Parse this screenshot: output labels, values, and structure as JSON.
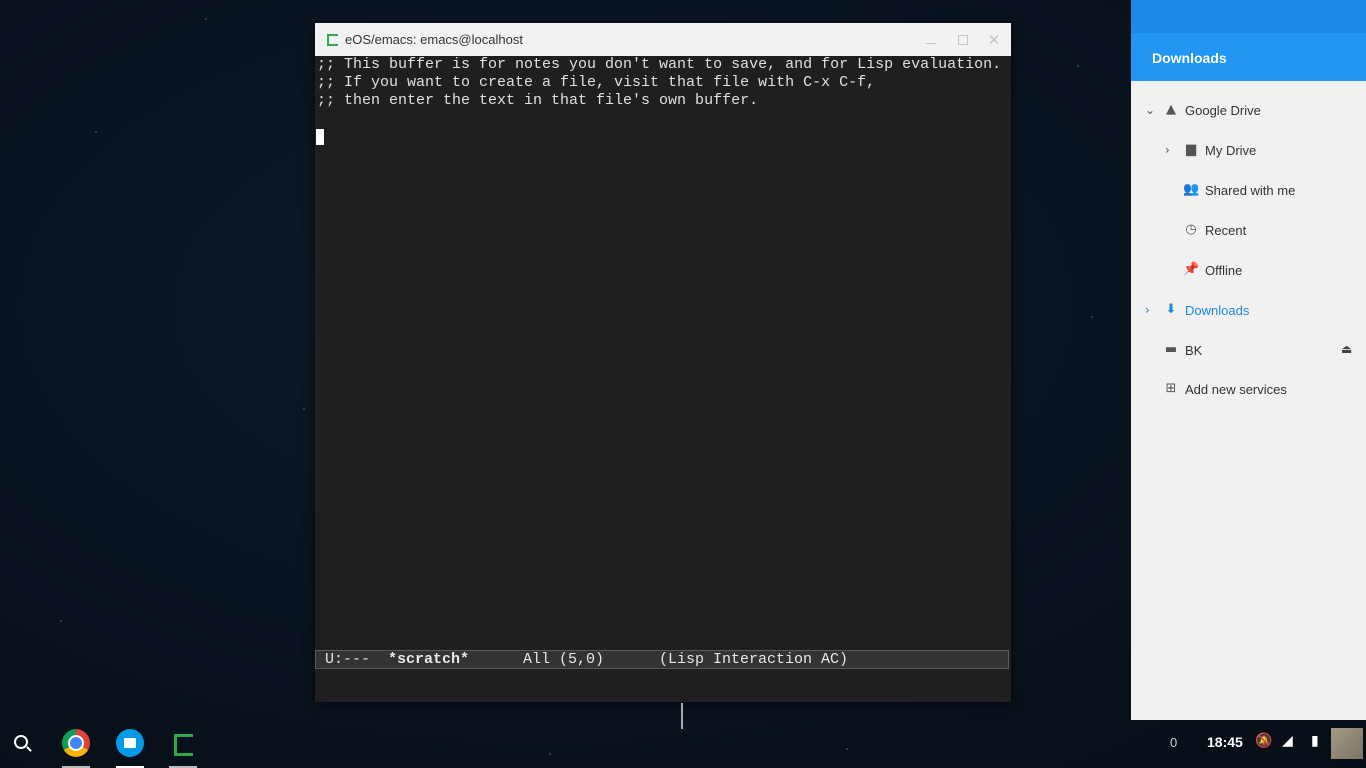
{
  "emacs": {
    "title": "eOS/emacs: emacs@localhost",
    "lines": [
      ";; This buffer is for notes you don't want to save, and for Lisp evaluation.",
      ";; If you want to create a file, visit that file with C-x C-f,",
      ";; then enter the text in that file's own buffer."
    ],
    "modeline": {
      "status": "U:---",
      "buffer": "*scratch*",
      "position": "All (5,0)",
      "mode": "(Lisp Interaction AC)"
    }
  },
  "files": {
    "header": "Downloads",
    "nav": [
      {
        "label": "Google Drive",
        "icon": "drive-icon",
        "expanded": true
      },
      {
        "label": "My Drive",
        "icon": "folder-drive-icon"
      },
      {
        "label": "Shared with me",
        "icon": "people-icon"
      },
      {
        "label": "Recent",
        "icon": "clock-icon"
      },
      {
        "label": "Offline",
        "icon": "pin-icon"
      },
      {
        "label": "Downloads",
        "icon": "download-icon",
        "active": true
      },
      {
        "label": "BK",
        "icon": "drive-usb-icon"
      },
      {
        "label": "Add new services",
        "icon": "plus-icon"
      }
    ],
    "accent": "#2196f3"
  },
  "shelf": {
    "apps": [
      "search-icon",
      "chrome-icon",
      "files-icon",
      "emacs-icon"
    ],
    "notification_count": "0",
    "clock": "18:45"
  }
}
